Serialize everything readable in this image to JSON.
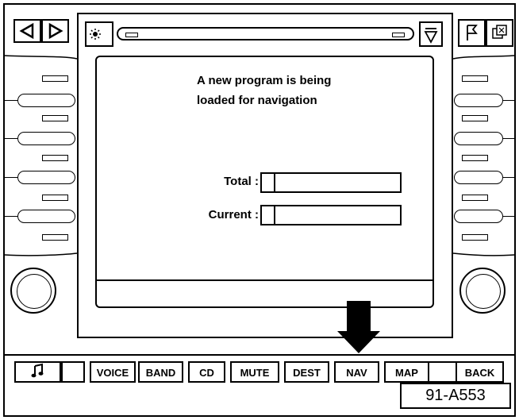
{
  "screen": {
    "message_line1": "A new program is being",
    "message_line2": "loaded for navigation",
    "total_label": "Total :",
    "current_label": "Current :",
    "total_progress": 0.1,
    "current_progress": 0.1
  },
  "bottom_buttons": {
    "music_icon": "music-note-icon",
    "voice": "VOICE",
    "band": "BAND",
    "cd": "CD",
    "mute": "MUTE",
    "dest": "DEST",
    "nav": "NAV",
    "map": "MAP",
    "back": "BACK"
  },
  "figure_label": "91-A553",
  "icons": {
    "seek_back": "triangle-left-icon",
    "seek_forward": "triangle-right-icon",
    "brightness": "sun-moon-icon",
    "eject": "eject-icon",
    "flag": "flag-icon",
    "info": "info-icon",
    "arrow": "down-arrow-icon"
  }
}
